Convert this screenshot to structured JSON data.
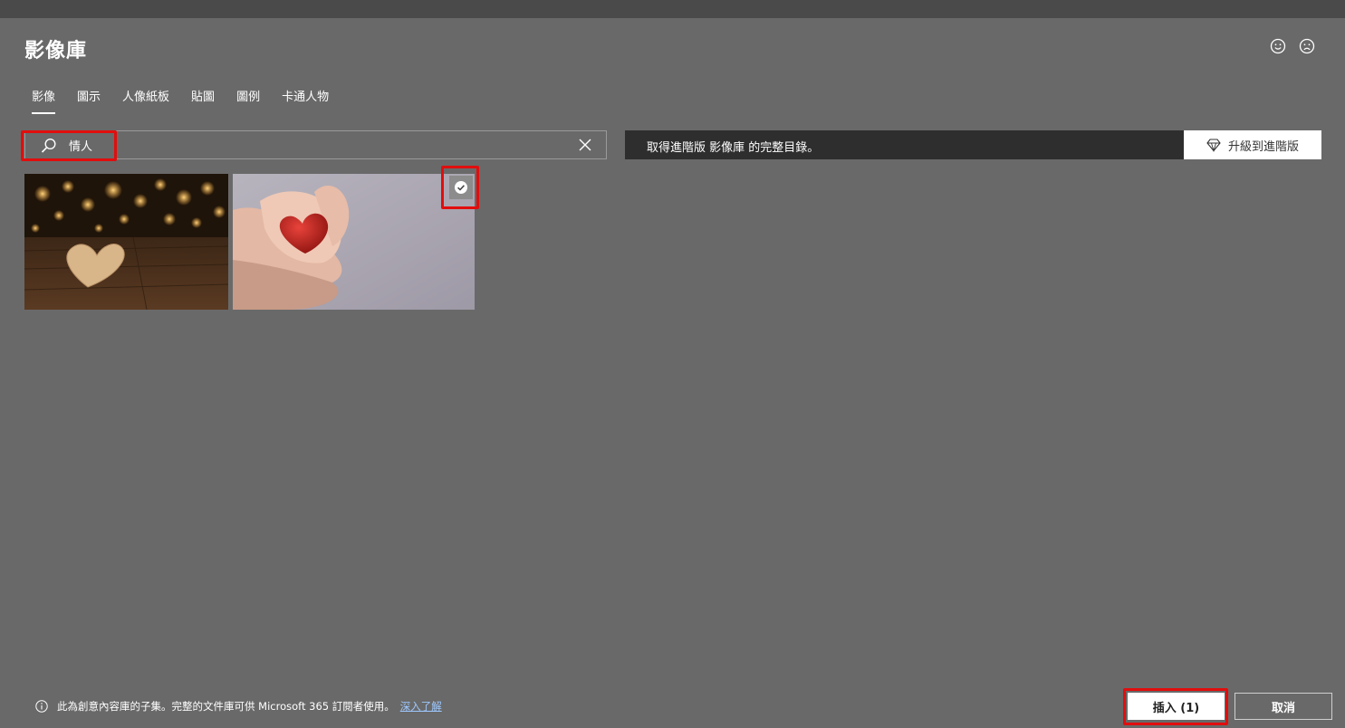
{
  "dialog": {
    "title": "影像庫",
    "feedback": {
      "like_icon": "smile-icon",
      "dislike_icon": "frown-icon"
    }
  },
  "tabs": [
    {
      "label": "影像",
      "active": true
    },
    {
      "label": "圖示",
      "active": false
    },
    {
      "label": "人像紙板",
      "active": false
    },
    {
      "label": "貼圖",
      "active": false
    },
    {
      "label": "圖例",
      "active": false
    },
    {
      "label": "卡通人物",
      "active": false
    }
  ],
  "search": {
    "value": "情人",
    "icon": "search-icon",
    "clear_icon": "close-icon"
  },
  "promo": {
    "text": "取得進階版 影像庫 的完整目錄。",
    "upgrade_label": "升級到進階版",
    "upgrade_icon": "diamond-icon"
  },
  "results": [
    {
      "description_icon": "wooden-heart-bokeh-image",
      "selected": false
    },
    {
      "description_icon": "hands-holding-red-heart-image",
      "selected": true
    }
  ],
  "footer": {
    "info_text": "此為創意內容庫的子集。完整的文件庫可供 Microsoft 365 訂閱者使用。",
    "learn_more": "深入了解",
    "insert_label": "插入 (1)",
    "cancel_label": "取消"
  },
  "colors": {
    "background": "#696969",
    "highlight": "#e20d0d",
    "promo_bar": "#2e2e2e",
    "link": "#9ec8ff"
  }
}
